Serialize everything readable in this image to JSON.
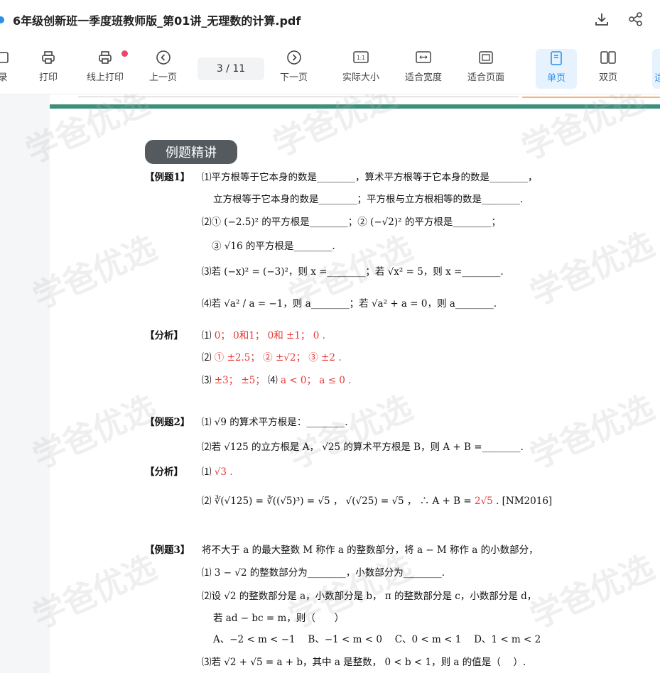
{
  "titlebar": {
    "title": "6年级创新班一季度班教师版_第01讲_无理数的计算.pdf"
  },
  "toolbar": {
    "items": [
      {
        "label": "录"
      },
      {
        "label": "打印"
      },
      {
        "label": "线上打印"
      },
      {
        "label": "上一页"
      },
      {
        "label": "下一页"
      },
      {
        "label": "实际大小"
      },
      {
        "label": "适合宽度"
      },
      {
        "label": "适合页面"
      },
      {
        "label": "单页"
      },
      {
        "label": "双页"
      },
      {
        "label": "适"
      }
    ],
    "page_indicator": "3 / 11",
    "actual_size_icon": "1:1"
  },
  "document": {
    "section_title": "例题精讲",
    "watermark": "学爸优选",
    "ex1": {
      "label": "【例题1】",
      "q1a": "⑴平方根等于它本身的数是________，算术平方根等于它本身的数是________，",
      "q1b": "立方根等于它本身的数是________；平方根与立方根相等的数是________.",
      "q2": "⑵① (−2.5)² 的平方根是________；② (−√2)² 的平方根是________；",
      "q2b": "③ √16 的平方根是________.",
      "q3": "⑶若 (−x)² = (−3)²，则 x =________；若 √x² = 5，则 x =________.",
      "q4": "⑷若 √a² / a = −1，则 a________；若 √a² + a = 0，则 a________."
    },
    "ans1": {
      "label": "【分析】",
      "a1_prefix": "⑴",
      "a1": "0； 0和1； 0和 ±1； 0 .",
      "a2_prefix": "⑵",
      "a2": "① ±2.5； ② ±√2； ③ ±2 .",
      "a3_prefix": "⑶",
      "a3": "±3； ±5；",
      "a3b_prefix": "⑷",
      "a3b": "a < 0； a ≤ 0 ."
    },
    "ex2": {
      "label": "【例题2】",
      "q1": "⑴ √9 的算术平方根是：________.",
      "q2": "⑵若 √125 的立方根是 A， √25 的算术平方根是 B，则 A + B =________."
    },
    "ans2": {
      "label": "【分析】",
      "a1_prefix": "⑴",
      "a1": "√3 .",
      "a2_prefix": "⑵",
      "a2": "∛(√125) = ∛((√5)³) = √5 ， √(√25) = √5 ， ∴ A + B =",
      "a2_red": "2√5",
      "a2_tail": ". [NM2016]"
    },
    "ex3": {
      "label": "【例题3】",
      "intro": "将不大于 a 的最大整数 M 称作 a 的整数部分，将 a − M 称作 a 的小数部分，",
      "q1": "⑴ 3 − √2 的整数部分为________，小数部分为________.",
      "q2": "⑵设 √2 的整数部分是 a，小数部分是 b， π 的整数部分是 c，小数部分是 d，",
      "q2b": "若 ad − bc = m，则（　　）",
      "q2c": "A、−2 < m < −1　 B、−1 < m < 0　 C、0 < m < 1　 D、1 < m < 2",
      "q3": "⑶若 √2 + √5 = a + b，其中 a 是整数， 0 < b < 1，则 a 的值是（　 ）."
    }
  }
}
